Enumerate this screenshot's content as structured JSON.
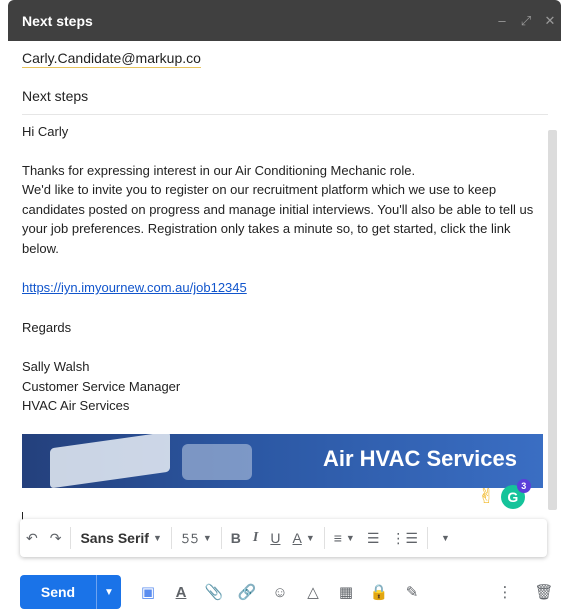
{
  "window": {
    "title": "Next steps"
  },
  "compose": {
    "to": "Carly.Candidate@markup.co",
    "subject": "Next steps",
    "greeting": "Hi Carly",
    "paragraph1_line1": "Thanks for expressing interest in our Air Conditioning Mechanic role.",
    "paragraph1_rest": "We'd like to invite you to register on our recruitment platform which we use to keep candidates posted on progress and manage initial interviews. You'll also be able to tell us your job preferences. Registration only takes a minute so, to get started, click the link below.",
    "link": "https://iyn.imyournew.com.au/job12345",
    "closing": "Regards",
    "signature": {
      "name": "Sally Walsh",
      "role": "Customer Service Manager",
      "company": "HVAC Air Services"
    },
    "banner_title": "Air HVAC Services"
  },
  "grammarly": {
    "letter": "G",
    "badge": "3"
  },
  "format_toolbar": {
    "font": "Sans Serif"
  },
  "buttons": {
    "send": "Send"
  },
  "icons": {
    "minimize": "minimize-icon",
    "expand": "expand-icon",
    "close": "close-icon"
  },
  "colors": {
    "titlebar": "#404040",
    "send": "#1a73e8",
    "link": "#1155cc",
    "grammarly": "#15c39a"
  }
}
